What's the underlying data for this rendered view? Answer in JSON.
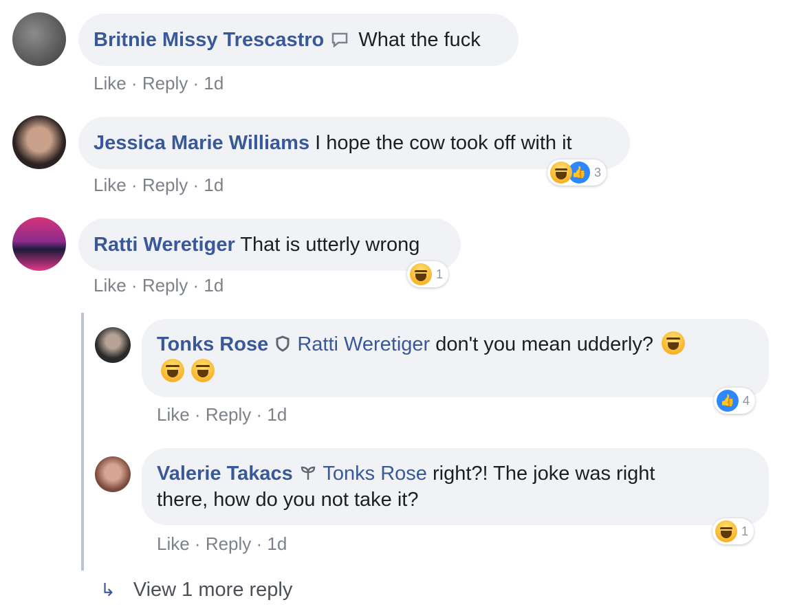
{
  "comments": [
    {
      "author": "Britnie Missy Trescastro",
      "badge_icon": "speech-bubble-icon",
      "text": "What the fuck",
      "actions": {
        "like": "Like",
        "reply": "Reply",
        "time": "1d"
      }
    },
    {
      "author": "Jessica Marie Williams",
      "text": "I hope the cow took off with it",
      "reactions": {
        "types": [
          "haha",
          "like"
        ],
        "count": "3"
      },
      "actions": {
        "like": "Like",
        "reply": "Reply",
        "time": "1d"
      }
    },
    {
      "author": "Ratti Weretiger",
      "text": "That is utterly wrong",
      "reactions": {
        "types": [
          "haha"
        ],
        "count": "1"
      },
      "actions": {
        "like": "Like",
        "reply": "Reply",
        "time": "1d"
      }
    }
  ],
  "replies": [
    {
      "author": "Tonks Rose",
      "badge_icon": "shield-icon",
      "mention": "Ratti Weretiger",
      "text": "don't you mean udderly?",
      "reactions": {
        "types": [
          "like"
        ],
        "count": "4"
      },
      "actions": {
        "like": "Like",
        "reply": "Reply",
        "time": "1d"
      }
    },
    {
      "author": "Valerie Takacs",
      "badge_icon": "sprout-icon",
      "mention": "Tonks Rose",
      "text_line1": "right?! The joke was right",
      "text_line2": "there, how do you not take it?",
      "reactions": {
        "types": [
          "haha"
        ],
        "count": "1"
      },
      "actions": {
        "like": "Like",
        "reply": "Reply",
        "time": "1d"
      }
    }
  ],
  "view_more": "View 1 more reply",
  "colors": {
    "name": "#385898",
    "bubble": "#f1f2f5",
    "meta": "#7d828a",
    "thread_line": "#bcc3cf"
  }
}
